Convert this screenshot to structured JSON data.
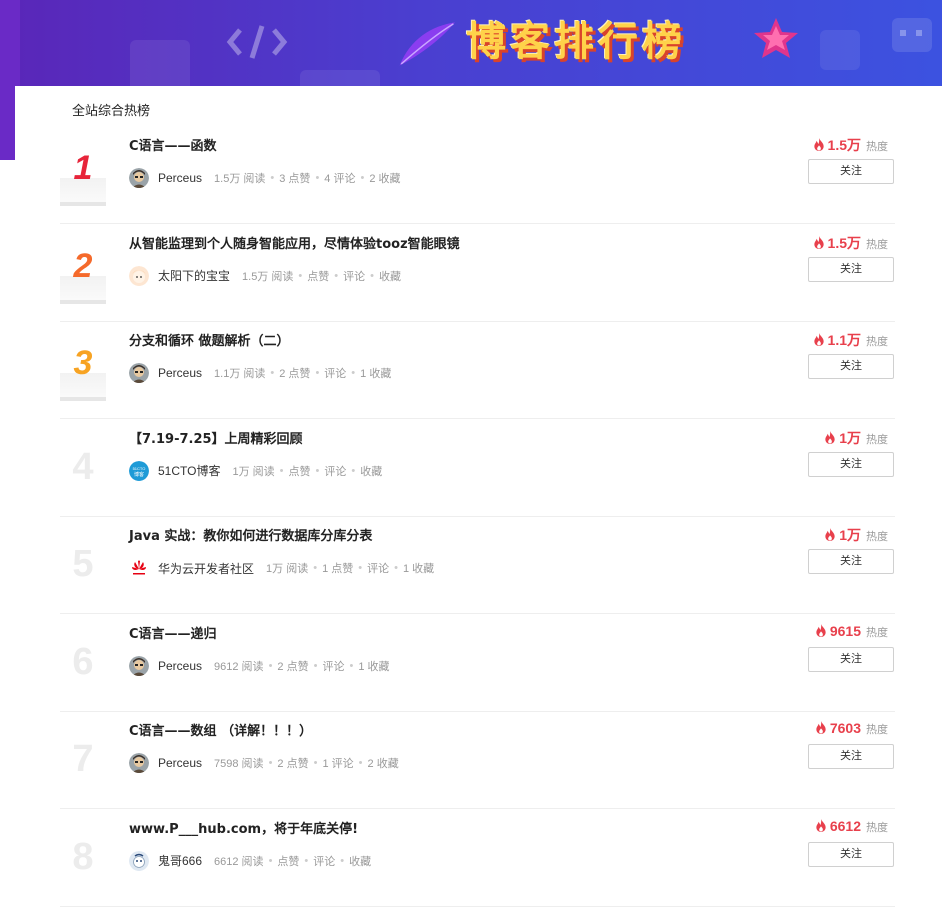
{
  "banner": {
    "title": "博客排行榜"
  },
  "section_title": "全站综合热榜",
  "follow_label": "关注",
  "heat_label": "热度",
  "items": [
    {
      "rank": "1",
      "rank_color": "#e7243a",
      "title": "C语言——函数",
      "author": "Perceus",
      "avatar": "perceus",
      "stats": [
        "1.5万 阅读",
        "3 点赞",
        "4 评论",
        "2 收藏"
      ],
      "heat": "1.5万"
    },
    {
      "rank": "2",
      "rank_color": "#f56a2b",
      "title": "从智能监理到个人随身智能应用，尽情体验tooz智能眼镜",
      "author": "太阳下的宝宝",
      "avatar": "baobao",
      "stats": [
        "1.5万 阅读",
        "点赞",
        "评论",
        "收藏"
      ],
      "heat": "1.5万"
    },
    {
      "rank": "3",
      "rank_color": "#f7a323",
      "title": "分支和循环 做题解析（二）",
      "author": "Perceus",
      "avatar": "perceus",
      "stats": [
        "1.1万 阅读",
        "2 点赞",
        "评论",
        "1 收藏"
      ],
      "heat": "1.1万"
    },
    {
      "rank": "4",
      "rank_color": "",
      "title": "【7.19-7.25】上周精彩回顾",
      "author": "51CTO博客",
      "avatar": "51cto",
      "stats": [
        "1万 阅读",
        "点赞",
        "评论",
        "收藏"
      ],
      "heat": "1万"
    },
    {
      "rank": "5",
      "rank_color": "",
      "title": "Java 实战：教你如何进行数据库分库分表",
      "author": "华为云开发者社区",
      "avatar": "huawei",
      "stats": [
        "1万 阅读",
        "1 点赞",
        "评论",
        "1 收藏"
      ],
      "heat": "1万"
    },
    {
      "rank": "6",
      "rank_color": "",
      "title": "C语言——递归",
      "author": "Perceus",
      "avatar": "perceus",
      "stats": [
        "9612 阅读",
        "2 点赞",
        "评论",
        "1 收藏"
      ],
      "heat": "9615"
    },
    {
      "rank": "7",
      "rank_color": "",
      "title": "C语言——数组 （详解！！！）",
      "author": "Perceus",
      "avatar": "perceus",
      "stats": [
        "7598 阅读",
        "2 点赞",
        "1 评论",
        "2 收藏"
      ],
      "heat": "7603"
    },
    {
      "rank": "8",
      "rank_color": "",
      "title": "www.P___hub.com，将于年底关停!",
      "author": "鬼哥666",
      "avatar": "guige",
      "stats": [
        "6612 阅读",
        "点赞",
        "评论",
        "收藏"
      ],
      "heat": "6612"
    }
  ]
}
